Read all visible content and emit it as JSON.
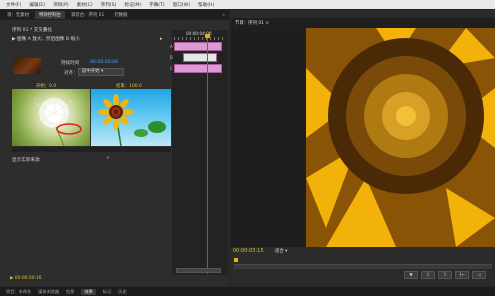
{
  "menu": {
    "items": [
      "文件(F)",
      "编辑(E)",
      "项目(P)",
      "素材(C)",
      "序列(S)",
      "标记(M)",
      "字幕(T)",
      "窗口(W)",
      "帮助(H)"
    ]
  },
  "left_panel": {
    "tabs": [
      "源：无素材",
      "特效控制台",
      "调音台：序列 01",
      "元数据"
    ],
    "active_tab_index": 1,
    "more_label": "»",
    "effect_title": "序列 01 * 交叉叠化",
    "clip_line": "▶ 图像 A 放大，然后图像 B 缩小",
    "duration_label": "持续时间",
    "duration_value": "00:00:00:00",
    "alignment_label": "对齐：",
    "alignment_value": "居中开始",
    "start_label": "开始：0.0",
    "end_label": "结束：100.0",
    "reverse_label": "显示实际来源",
    "reverse_checked": "✓",
    "status_text": "▶ 00:00:00:16"
  },
  "timeline": {
    "time": "00:00:04:00",
    "track_letters": [
      "A",
      "B",
      "C"
    ]
  },
  "right_panel": {
    "tab_label": "节目：序列 01 ×",
    "timecode": "00:00:03:15",
    "fit_label": "适合 ▾",
    "transport_icons": [
      "▼",
      "{",
      "}",
      "{←",
      "◁"
    ]
  },
  "bottom_tabs": {
    "items": [
      "项目：未命名",
      "媒体浏览器",
      "信息",
      "效果",
      "标记",
      "历史"
    ],
    "active_index": 3
  },
  "colors": {
    "accent_yellow": "#e0c232",
    "accent_blue": "#4aa3ff",
    "playhead_red": "#dd3333",
    "clip_pink": "#d99bd0"
  }
}
